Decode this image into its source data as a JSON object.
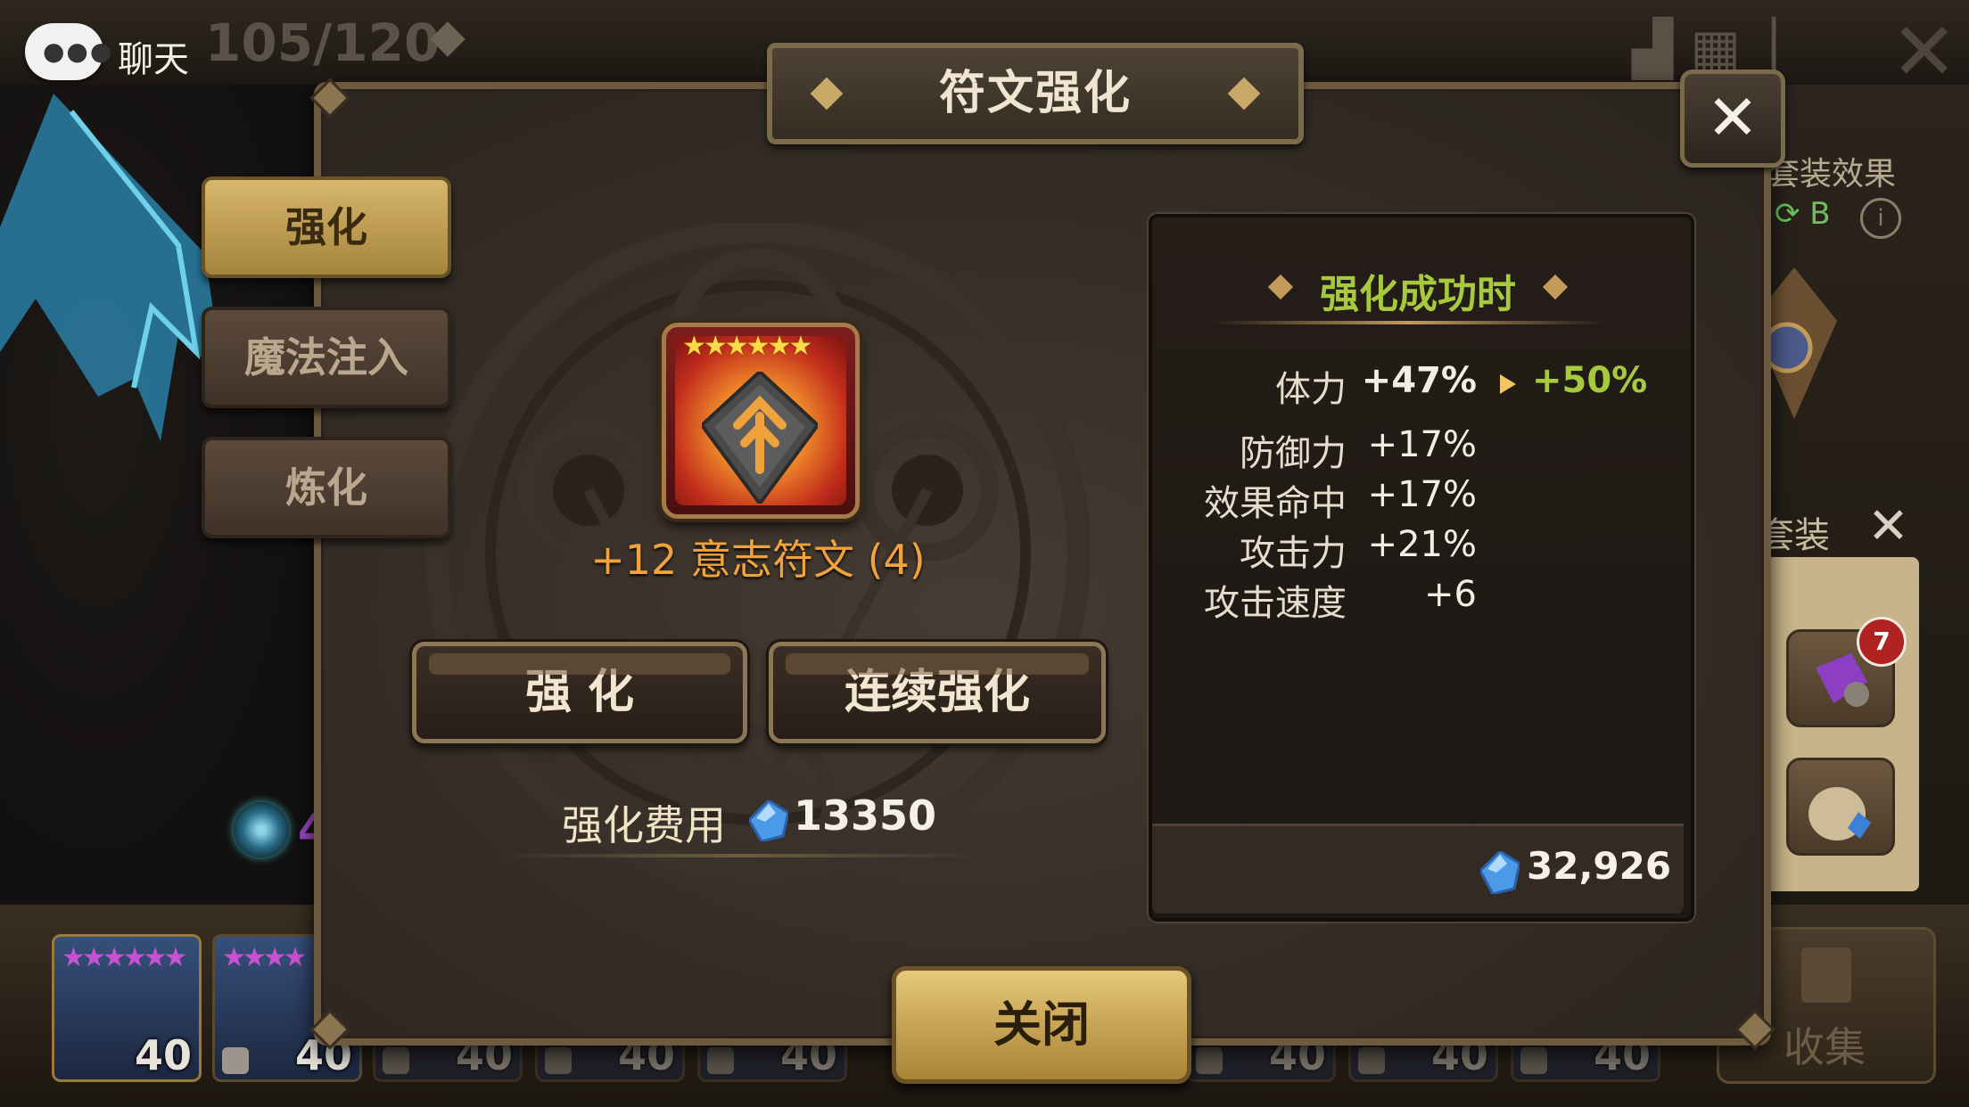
{
  "background": {
    "chat_label": "聊天",
    "top_count": "105/120",
    "set_panel": {
      "title": "套装效果",
      "tab_label": "套装",
      "badge_count": "7"
    },
    "collect_label": "收集",
    "hero_levels": [
      "40",
      "40",
      "40",
      "40",
      "40",
      "40",
      "40",
      "40"
    ],
    "partial_text": "4"
  },
  "modal": {
    "title": "符文强化",
    "close_icon": "close-icon",
    "tabs": [
      {
        "label": "强化",
        "active": true
      },
      {
        "label": "魔法注入",
        "active": false
      },
      {
        "label": "炼化",
        "active": false
      }
    ],
    "rune": {
      "stars": "★★★★★★",
      "name": "+12 意志符文 (4)"
    },
    "buttons": {
      "upgrade": "强 化",
      "continuous": "连续强化",
      "close": "关闭"
    },
    "cost": {
      "label": "强化费用",
      "value": "13350"
    },
    "info_panel": {
      "header": "强化成功时",
      "main_stat": {
        "label": "体力",
        "value": "+47%",
        "next": "+50%"
      },
      "sub_stats": [
        {
          "label": "防御力",
          "value": "+17%"
        },
        {
          "label": "效果命中",
          "value": "+17%"
        },
        {
          "label": "攻击力",
          "value": "+21%"
        },
        {
          "label": "攻击速度",
          "value": "+6"
        }
      ],
      "crystals": "32,926"
    }
  },
  "colors": {
    "accent_green": "#a7c93d",
    "accent_orange": "#f0a33c",
    "gold": "#c9a968"
  }
}
